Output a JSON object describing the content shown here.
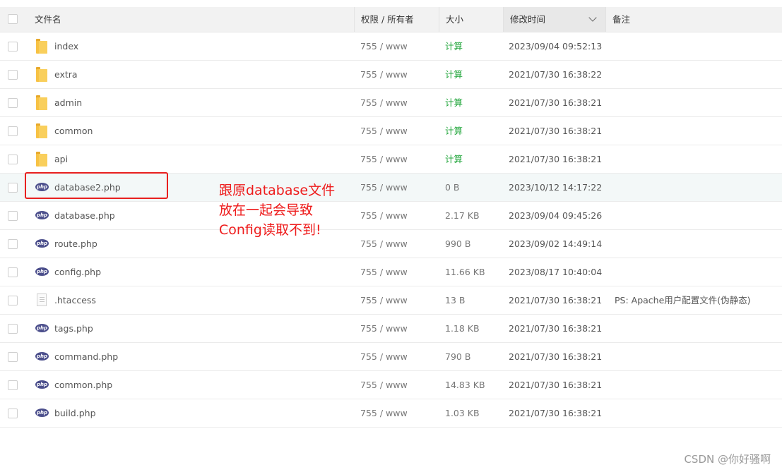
{
  "header": {
    "name": "文件名",
    "perm": "权限 / 所有者",
    "size": "大小",
    "mtime": "修改时间",
    "note": "备注"
  },
  "rows": [
    {
      "type": "folder",
      "name": "index",
      "perm": "755 / www",
      "size": "计算",
      "mtime": "2023/09/04 09:52:13",
      "note": ""
    },
    {
      "type": "folder",
      "name": "extra",
      "perm": "755 / www",
      "size": "计算",
      "mtime": "2021/07/30 16:38:22",
      "note": ""
    },
    {
      "type": "folder",
      "name": "admin",
      "perm": "755 / www",
      "size": "计算",
      "mtime": "2021/07/30 16:38:21",
      "note": ""
    },
    {
      "type": "folder",
      "name": "common",
      "perm": "755 / www",
      "size": "计算",
      "mtime": "2021/07/30 16:38:21",
      "note": ""
    },
    {
      "type": "folder",
      "name": "api",
      "perm": "755 / www",
      "size": "计算",
      "mtime": "2021/07/30 16:38:21",
      "note": ""
    },
    {
      "type": "php",
      "name": "database2.php",
      "perm": "755 / www",
      "size": "0 B",
      "mtime": "2023/10/12 14:17:22",
      "note": ""
    },
    {
      "type": "php",
      "name": "database.php",
      "perm": "755 / www",
      "size": "2.17 KB",
      "mtime": "2023/09/04 09:45:26",
      "note": ""
    },
    {
      "type": "php",
      "name": "route.php",
      "perm": "755 / www",
      "size": "990 B",
      "mtime": "2023/09/02 14:49:14",
      "note": ""
    },
    {
      "type": "php",
      "name": "config.php",
      "perm": "755 / www",
      "size": "11.66 KB",
      "mtime": "2023/08/17 10:40:04",
      "note": ""
    },
    {
      "type": "file",
      "name": ".htaccess",
      "perm": "755 / www",
      "size": "13 B",
      "mtime": "2021/07/30 16:38:21",
      "note": "PS: Apache用户配置文件(伪静态)"
    },
    {
      "type": "php",
      "name": "tags.php",
      "perm": "755 / www",
      "size": "1.18 KB",
      "mtime": "2021/07/30 16:38:21",
      "note": ""
    },
    {
      "type": "php",
      "name": "command.php",
      "perm": "755 / www",
      "size": "790 B",
      "mtime": "2021/07/30 16:38:21",
      "note": ""
    },
    {
      "type": "php",
      "name": "common.php",
      "perm": "755 / www",
      "size": "14.83 KB",
      "mtime": "2021/07/30 16:38:21",
      "note": ""
    },
    {
      "type": "php",
      "name": "build.php",
      "perm": "755 / www",
      "size": "1.03 KB",
      "mtime": "2021/07/30 16:38:21",
      "note": ""
    }
  ],
  "highlight_row": 5,
  "icon_labels": {
    "php": "php"
  },
  "colors": {
    "calc_link": "#20a53a",
    "annotation": "#e8201f",
    "php_icon": "#4c4f8c",
    "folder": "#f7c244"
  },
  "annotation": {
    "lines": [
      "跟原database文件",
      "放在一起会导致",
      "Config读取不到!"
    ]
  },
  "watermark": "CSDN @你好骚啊"
}
